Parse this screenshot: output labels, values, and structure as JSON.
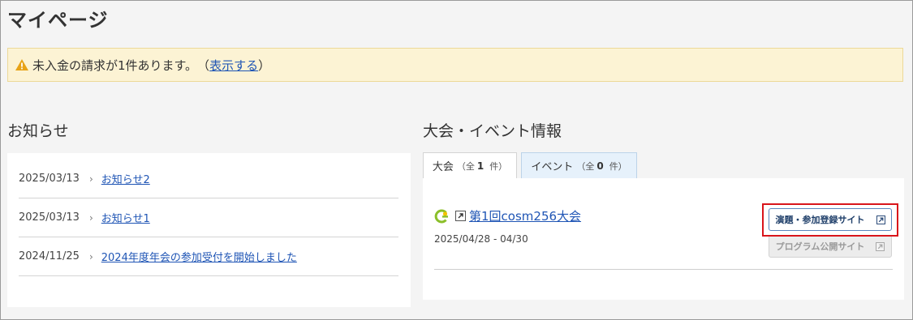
{
  "page": {
    "title": "マイページ"
  },
  "alert": {
    "message": "未入金の請求が1件あります。",
    "open_paren": "（",
    "link": "表示する",
    "close_paren": "）"
  },
  "news": {
    "title": "お知らせ",
    "items": [
      {
        "date": "2025/03/13",
        "title": "お知らせ2"
      },
      {
        "date": "2025/03/13",
        "title": "お知らせ1"
      },
      {
        "date": "2024/11/25",
        "title": "2024年度年会の参加受付を開始しました"
      }
    ],
    "separator": "›"
  },
  "events": {
    "title": "大会・イベント情報",
    "tabs": [
      {
        "label": "大会",
        "prefix": "（全",
        "count": "1",
        "suffix": "件）"
      },
      {
        "label": "イベント",
        "prefix": "（全",
        "count": "0",
        "suffix": "件）"
      }
    ],
    "card": {
      "name": "第1回cosm256大会",
      "dates": "2025/04/28 - 04/30",
      "register_button": "演題・参加登録サイト",
      "program_button": "プログラム公開サイト"
    }
  },
  "colors": {
    "link": "#1f55b5",
    "alert_bg": "#fcf3d4",
    "highlight": "#d9151b"
  }
}
